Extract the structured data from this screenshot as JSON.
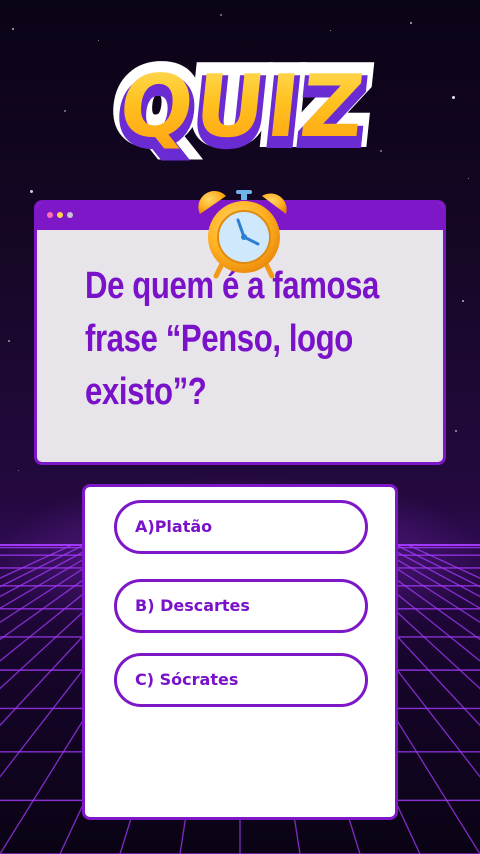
{
  "logo": {
    "text": "QUIZ"
  },
  "question": {
    "text": "De quem é a famosa frase “Penso, logo existo”?"
  },
  "answers": [
    {
      "label": "A)Platão"
    },
    {
      "label": "B) Descartes"
    },
    {
      "label": "C) Sócrates"
    }
  ],
  "colors": {
    "accent": "#7d17c7",
    "question_text": "#7a12c9",
    "logo_fill": "#ffc21f",
    "logo_shadow": "#6a2bd3"
  },
  "icons": {
    "window_dots": [
      "pink-dot",
      "yellow-dot",
      "gray-dot"
    ],
    "timer": "alarm-clock-icon"
  }
}
